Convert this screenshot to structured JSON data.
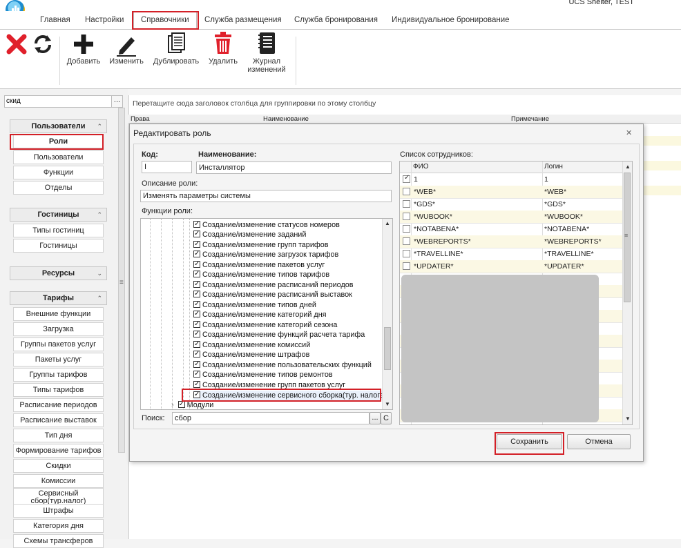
{
  "app": {
    "title": "UCS Shelter, TEST"
  },
  "tabs": [
    {
      "label": "Главная"
    },
    {
      "label": "Настройки"
    },
    {
      "label": "Справочники"
    },
    {
      "label": "Служба размещения"
    },
    {
      "label": "Служба бронирования"
    },
    {
      "label": "Индивидуальное бронирование"
    }
  ],
  "toolbar": {
    "add": "Добавить",
    "edit": "Изменить",
    "duplicate": "Дублировать",
    "delete": "Удалить",
    "journal_line1": "Журнал",
    "journal_line2": "изменений"
  },
  "sidebar": {
    "filter_value": "скид",
    "filter_btn": "...",
    "groups": {
      "users": {
        "label": "Пользователи",
        "items": [
          "Роли",
          "Пользователи",
          "Функции",
          "Отделы"
        ]
      },
      "hotels": {
        "label": "Гостиницы",
        "items": [
          "Типы гостиниц",
          "Гостиницы"
        ]
      },
      "resources": {
        "label": "Ресурсы"
      },
      "tariffs": {
        "label": "Тарифы",
        "items": [
          "Внешние функции",
          "Загрузка",
          "Группы пакетов услуг",
          "Пакеты услуг",
          "Группы тарифов",
          "Типы тарифов",
          "Расписание периодов",
          "Расписание выставок",
          "Тип дня",
          "Формирование тарифов",
          "Скидки",
          "Комиссии",
          "Сервисный",
          "сбор(тур.налог)",
          "Штрафы",
          "Категория дня",
          "Схемы трансферов"
        ]
      }
    }
  },
  "grid": {
    "group_hint": "Перетащите сюда заголовок столбца для группировки по этому столбцу",
    "columns": [
      "Права",
      "Наименование",
      "Примечание"
    ]
  },
  "dialog": {
    "title": "Редактировать роль",
    "code_label": "Код:",
    "code_value": "I",
    "name_label": "Наименование:",
    "name_value": "Инсталлятор",
    "desc_label": "Описание роли:",
    "desc_value": "Изменять параметры системы",
    "functions_label": "Функции роли:",
    "functions": [
      "Создание/изменение статусов номеров",
      "Создание/изменение заданий",
      "Создание/изменение групп тарифов",
      "Создание/изменение загрузок тарифов",
      "Создание/изменение пакетов услуг",
      "Создание/изменение типов тарифов",
      "Создание/изменение расписаний периодов",
      "Создание/изменение расписаний выставок",
      "Создание/изменение типов дней",
      "Создание/изменение категорий дня",
      "Создание/изменение категорий сезона",
      "Создание/изменение функций расчета тарифа",
      "Создание/изменение комиссий",
      "Создание/изменение штрафов",
      "Создание/изменение пользовательских функций",
      "Создание/изменение типов ремонтов",
      "Создание/изменение групп пакетов услуг",
      "Создание/изменение сервисного сборка(тур. налога)"
    ],
    "modules_label": "Модули",
    "search_label": "Поиск:",
    "search_value": "сбор",
    "search_dots": "...",
    "search_clear": "C",
    "employees_label": "Список сотрудников:",
    "emp_columns": [
      "ФИО",
      "Логин"
    ],
    "employees": [
      {
        "fio": "1",
        "login": "1",
        "checked": true
      },
      {
        "fio": "*WEB*",
        "login": "*WEB*",
        "checked": false
      },
      {
        "fio": "*GDS*",
        "login": "*GDS*",
        "checked": false
      },
      {
        "fio": "*WUBOOK*",
        "login": "*WUBOOK*",
        "checked": false
      },
      {
        "fio": "*NOTABENA*",
        "login": "*NOTABENA*",
        "checked": false
      },
      {
        "fio": "*WEBREPORTS*",
        "login": "*WEBREPORTS*",
        "checked": false
      },
      {
        "fio": "*TRAVELLINE*",
        "login": "*TRAVELLINE*",
        "checked": false
      },
      {
        "fio": "*UPDATER*",
        "login": "*UPDATER*",
        "checked": false
      }
    ],
    "save": "Сохранить",
    "cancel": "Отмена"
  }
}
